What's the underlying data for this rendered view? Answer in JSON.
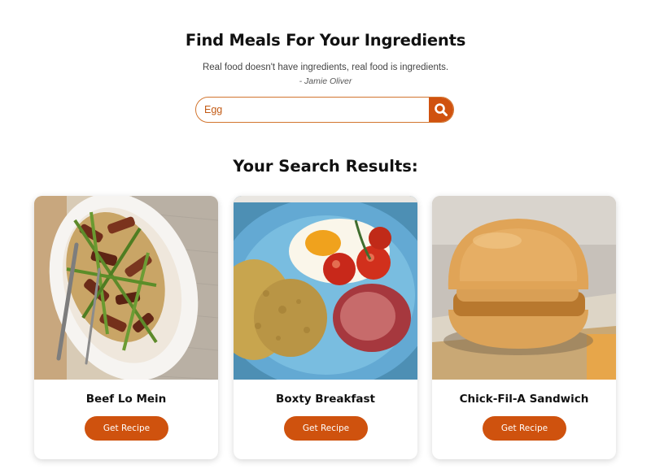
{
  "header": {
    "title": "Find Meals For Your Ingredients",
    "quote": "Real food doesn't have ingredients, real food is ingredients.",
    "quote_author": "- Jamie Oliver"
  },
  "search": {
    "value": "Egg",
    "button_icon": "search-icon"
  },
  "results": {
    "title": "Your Search Results:",
    "meals": [
      {
        "name": "Beef Lo Mein",
        "button_label": "Get Recipe"
      },
      {
        "name": "Boxty Breakfast",
        "button_label": "Get Recipe"
      },
      {
        "name": "Chick-Fil-A Sandwich",
        "button_label": "Get Recipe"
      }
    ]
  },
  "colors": {
    "accent": "#cf520e",
    "search_border": "#d2752f"
  }
}
